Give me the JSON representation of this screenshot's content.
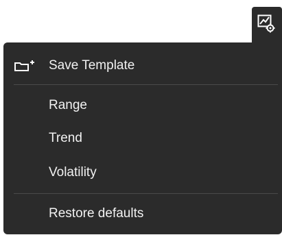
{
  "toolbar": {
    "settings_icon": "chart-settings-icon"
  },
  "menu": {
    "items": [
      {
        "label": "Save Template",
        "icon": "folder-add-icon"
      },
      {
        "label": "Range"
      },
      {
        "label": "Trend"
      },
      {
        "label": "Volatility"
      },
      {
        "label": "Restore defaults"
      }
    ]
  },
  "colors": {
    "panel_background": "#2b2b2b",
    "text": "#f2f2f2",
    "divider": "#4a4a4a"
  }
}
